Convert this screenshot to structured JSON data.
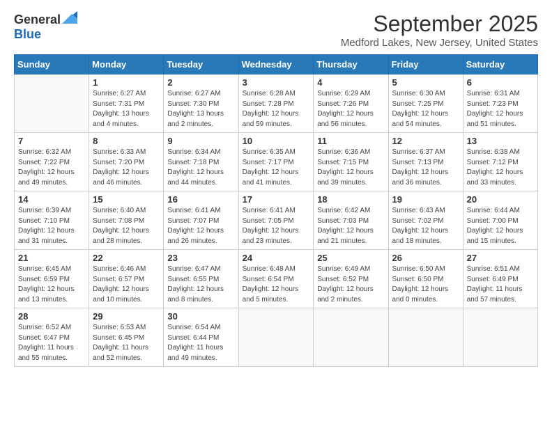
{
  "logo": {
    "general": "General",
    "blue": "Blue"
  },
  "header": {
    "title": "September 2025",
    "subtitle": "Medford Lakes, New Jersey, United States"
  },
  "days_of_week": [
    "Sunday",
    "Monday",
    "Tuesday",
    "Wednesday",
    "Thursday",
    "Friday",
    "Saturday"
  ],
  "weeks": [
    [
      {
        "day": "",
        "info": ""
      },
      {
        "day": "1",
        "info": "Sunrise: 6:27 AM\nSunset: 7:31 PM\nDaylight: 13 hours\nand 4 minutes."
      },
      {
        "day": "2",
        "info": "Sunrise: 6:27 AM\nSunset: 7:30 PM\nDaylight: 13 hours\nand 2 minutes."
      },
      {
        "day": "3",
        "info": "Sunrise: 6:28 AM\nSunset: 7:28 PM\nDaylight: 12 hours\nand 59 minutes."
      },
      {
        "day": "4",
        "info": "Sunrise: 6:29 AM\nSunset: 7:26 PM\nDaylight: 12 hours\nand 56 minutes."
      },
      {
        "day": "5",
        "info": "Sunrise: 6:30 AM\nSunset: 7:25 PM\nDaylight: 12 hours\nand 54 minutes."
      },
      {
        "day": "6",
        "info": "Sunrise: 6:31 AM\nSunset: 7:23 PM\nDaylight: 12 hours\nand 51 minutes."
      }
    ],
    [
      {
        "day": "7",
        "info": "Sunrise: 6:32 AM\nSunset: 7:22 PM\nDaylight: 12 hours\nand 49 minutes."
      },
      {
        "day": "8",
        "info": "Sunrise: 6:33 AM\nSunset: 7:20 PM\nDaylight: 12 hours\nand 46 minutes."
      },
      {
        "day": "9",
        "info": "Sunrise: 6:34 AM\nSunset: 7:18 PM\nDaylight: 12 hours\nand 44 minutes."
      },
      {
        "day": "10",
        "info": "Sunrise: 6:35 AM\nSunset: 7:17 PM\nDaylight: 12 hours\nand 41 minutes."
      },
      {
        "day": "11",
        "info": "Sunrise: 6:36 AM\nSunset: 7:15 PM\nDaylight: 12 hours\nand 39 minutes."
      },
      {
        "day": "12",
        "info": "Sunrise: 6:37 AM\nSunset: 7:13 PM\nDaylight: 12 hours\nand 36 minutes."
      },
      {
        "day": "13",
        "info": "Sunrise: 6:38 AM\nSunset: 7:12 PM\nDaylight: 12 hours\nand 33 minutes."
      }
    ],
    [
      {
        "day": "14",
        "info": "Sunrise: 6:39 AM\nSunset: 7:10 PM\nDaylight: 12 hours\nand 31 minutes."
      },
      {
        "day": "15",
        "info": "Sunrise: 6:40 AM\nSunset: 7:08 PM\nDaylight: 12 hours\nand 28 minutes."
      },
      {
        "day": "16",
        "info": "Sunrise: 6:41 AM\nSunset: 7:07 PM\nDaylight: 12 hours\nand 26 minutes."
      },
      {
        "day": "17",
        "info": "Sunrise: 6:41 AM\nSunset: 7:05 PM\nDaylight: 12 hours\nand 23 minutes."
      },
      {
        "day": "18",
        "info": "Sunrise: 6:42 AM\nSunset: 7:03 PM\nDaylight: 12 hours\nand 21 minutes."
      },
      {
        "day": "19",
        "info": "Sunrise: 6:43 AM\nSunset: 7:02 PM\nDaylight: 12 hours\nand 18 minutes."
      },
      {
        "day": "20",
        "info": "Sunrise: 6:44 AM\nSunset: 7:00 PM\nDaylight: 12 hours\nand 15 minutes."
      }
    ],
    [
      {
        "day": "21",
        "info": "Sunrise: 6:45 AM\nSunset: 6:59 PM\nDaylight: 12 hours\nand 13 minutes."
      },
      {
        "day": "22",
        "info": "Sunrise: 6:46 AM\nSunset: 6:57 PM\nDaylight: 12 hours\nand 10 minutes."
      },
      {
        "day": "23",
        "info": "Sunrise: 6:47 AM\nSunset: 6:55 PM\nDaylight: 12 hours\nand 8 minutes."
      },
      {
        "day": "24",
        "info": "Sunrise: 6:48 AM\nSunset: 6:54 PM\nDaylight: 12 hours\nand 5 minutes."
      },
      {
        "day": "25",
        "info": "Sunrise: 6:49 AM\nSunset: 6:52 PM\nDaylight: 12 hours\nand 2 minutes."
      },
      {
        "day": "26",
        "info": "Sunrise: 6:50 AM\nSunset: 6:50 PM\nDaylight: 12 hours\nand 0 minutes."
      },
      {
        "day": "27",
        "info": "Sunrise: 6:51 AM\nSunset: 6:49 PM\nDaylight: 11 hours\nand 57 minutes."
      }
    ],
    [
      {
        "day": "28",
        "info": "Sunrise: 6:52 AM\nSunset: 6:47 PM\nDaylight: 11 hours\nand 55 minutes."
      },
      {
        "day": "29",
        "info": "Sunrise: 6:53 AM\nSunset: 6:45 PM\nDaylight: 11 hours\nand 52 minutes."
      },
      {
        "day": "30",
        "info": "Sunrise: 6:54 AM\nSunset: 6:44 PM\nDaylight: 11 hours\nand 49 minutes."
      },
      {
        "day": "",
        "info": ""
      },
      {
        "day": "",
        "info": ""
      },
      {
        "day": "",
        "info": ""
      },
      {
        "day": "",
        "info": ""
      }
    ]
  ]
}
